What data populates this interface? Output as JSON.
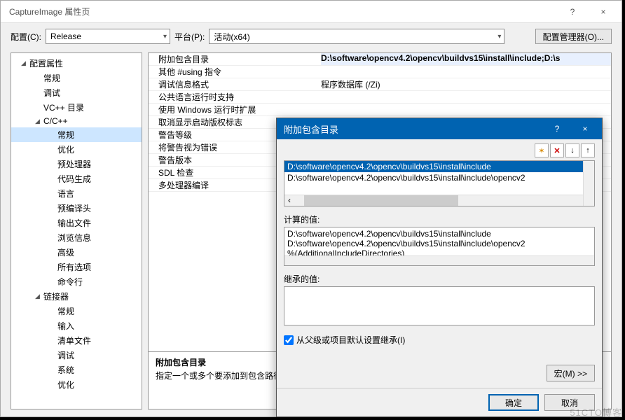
{
  "window": {
    "title": "CaptureImage 属性页",
    "help": "?",
    "close": "×"
  },
  "toolbar": {
    "config_label": "配置(C):",
    "config_value": "Release",
    "platform_label": "平台(P):",
    "platform_value": "活动(x64)",
    "manager_btn": "配置管理器(O)..."
  },
  "tree": {
    "root": "配置属性",
    "items": [
      {
        "label": "常规",
        "level": 2
      },
      {
        "label": "调试",
        "level": 2
      },
      {
        "label": "VC++ 目录",
        "level": 2
      },
      {
        "label": "C/C++",
        "level": 2,
        "expandable": true
      },
      {
        "label": "常规",
        "level": 3,
        "selected": true
      },
      {
        "label": "优化",
        "level": 3
      },
      {
        "label": "预处理器",
        "level": 3
      },
      {
        "label": "代码生成",
        "level": 3
      },
      {
        "label": "语言",
        "level": 3
      },
      {
        "label": "预编译头",
        "level": 3
      },
      {
        "label": "输出文件",
        "level": 3
      },
      {
        "label": "浏览信息",
        "level": 3
      },
      {
        "label": "高级",
        "level": 3
      },
      {
        "label": "所有选项",
        "level": 3
      },
      {
        "label": "命令行",
        "level": 3
      },
      {
        "label": "链接器",
        "level": 2,
        "expandable": true
      },
      {
        "label": "常规",
        "level": 3
      },
      {
        "label": "输入",
        "level": 3
      },
      {
        "label": "清单文件",
        "level": 3
      },
      {
        "label": "调试",
        "level": 3
      },
      {
        "label": "系统",
        "level": 3
      },
      {
        "label": "优化",
        "level": 3
      }
    ]
  },
  "grid": {
    "rows": [
      {
        "k": "附加包含目录",
        "v": "D:\\software\\opencv4.2\\opencv\\buildvs15\\install\\include;D:\\s",
        "sel": true
      },
      {
        "k": "其他 #using 指令",
        "v": ""
      },
      {
        "k": "调试信息格式",
        "v": "程序数据库 (/Zi)"
      },
      {
        "k": "公共语言运行时支持",
        "v": ""
      },
      {
        "k": "使用 Windows 运行时扩展",
        "v": ""
      },
      {
        "k": "取消显示启动版权标志",
        "v": ""
      },
      {
        "k": "警告等级",
        "v": ""
      },
      {
        "k": "将警告视为错误",
        "v": ""
      },
      {
        "k": "警告版本",
        "v": ""
      },
      {
        "k": "SDL 检查",
        "v": ""
      },
      {
        "k": "多处理器编译",
        "v": ""
      }
    ],
    "desc_title": "附加包含目录",
    "desc_text": "指定一个或多个要添加到包含路径"
  },
  "modal": {
    "title": "附加包含目录",
    "help": "?",
    "close": "×",
    "icons": {
      "new": "✶",
      "folder": "📁",
      "del": "✕",
      "down": "↓",
      "up": "↑"
    },
    "list": [
      {
        "text": "D:\\software\\opencv4.2\\opencv\\buildvs15\\install\\include",
        "sel": true
      },
      {
        "text": "D:\\software\\opencv4.2\\opencv\\buildvs15\\install\\include\\opencv2",
        "sel": false
      }
    ],
    "calculated_label": "计算的值:",
    "calculated": [
      "D:\\software\\opencv4.2\\opencv\\buildvs15\\install\\include",
      "D:\\software\\opencv4.2\\opencv\\buildvs15\\install\\include\\opencv2",
      "%(AdditionalIncludeDirectories)"
    ],
    "inherited_label": "继承的值:",
    "inherit_chk": "从父级或项目默认设置继承(I)",
    "macro_btn": "宏(M) >>",
    "ok": "确定",
    "cancel": "取消"
  },
  "watermark": "51CTO博客"
}
